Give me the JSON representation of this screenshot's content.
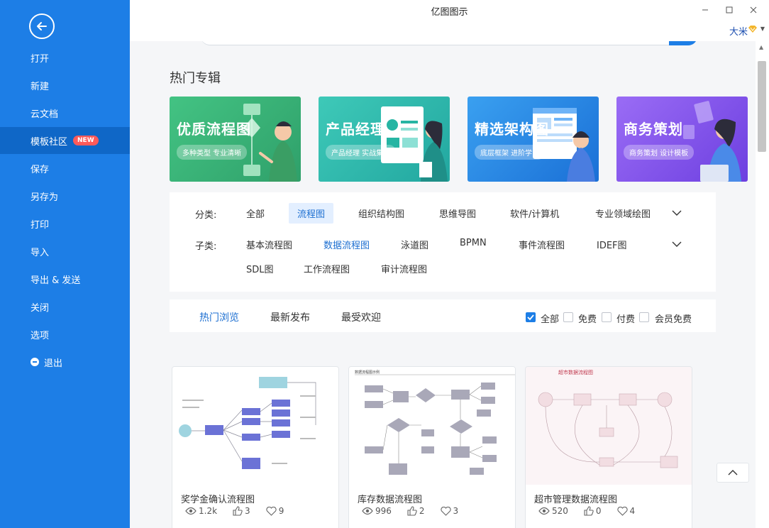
{
  "app": {
    "title": "亿图图示",
    "user_name": "大米"
  },
  "sidebar": {
    "items": [
      {
        "label": "打开"
      },
      {
        "label": "新建"
      },
      {
        "label": "云文档"
      },
      {
        "label": "模板社区",
        "badge": "NEW",
        "active": true
      },
      {
        "label": "保存"
      },
      {
        "label": "另存为"
      },
      {
        "label": "打印"
      },
      {
        "label": "导入"
      },
      {
        "label": "导出 & 发送"
      },
      {
        "label": "关闭"
      },
      {
        "label": "选项"
      },
      {
        "label": "退出"
      }
    ]
  },
  "main": {
    "section_title": "热门专辑",
    "banners": [
      {
        "title": "优质流程图",
        "subtitle": "多种类型 专业清晰",
        "color": "#3fbf7f"
      },
      {
        "title": "产品经理",
        "subtitle": "产品经理 实战集合",
        "color": "#34c3b5"
      },
      {
        "title": "精选架构图",
        "subtitle": "底层框架 进阶学习",
        "color": "#2f8ee8"
      },
      {
        "title": "商务策划",
        "subtitle": "商务策划 设计模板",
        "color": "#8a5cf0"
      }
    ],
    "filter": {
      "category_label": "分类:",
      "categories": [
        "全部",
        "流程图",
        "组织结构图",
        "思维导图",
        "软件/计算机",
        "专业领域绘图"
      ],
      "selected_category": "流程图",
      "subcategory_label": "子类:",
      "subcategories": [
        "基本流程图",
        "数据流程图",
        "泳道图",
        "BPMN",
        "事件流程图",
        "IDEF图",
        "SDL图",
        "工作流程图",
        "审计流程图"
      ],
      "selected_subcategory": "数据流程图"
    },
    "sort": {
      "tabs": [
        "热门浏览",
        "最新发布",
        "最受欢迎"
      ],
      "active_tab": "热门浏览",
      "checkboxes": [
        {
          "label": "全部",
          "checked": true
        },
        {
          "label": "免费",
          "checked": false
        },
        {
          "label": "付费",
          "checked": false
        },
        {
          "label": "会员免费",
          "checked": false
        }
      ]
    },
    "cards": [
      {
        "title": "奖学金确认流程图",
        "views": "1.2k",
        "likes": "3",
        "favorites": "9"
      },
      {
        "title": "库存数据流程图",
        "views": "996",
        "likes": "2",
        "favorites": "3",
        "thumb_title": "数据流程图示例"
      },
      {
        "title": "超市管理数据流程图",
        "views": "520",
        "likes": "0",
        "favorites": "4",
        "thumb_title": "超市数据流程图"
      }
    ]
  },
  "colors": {
    "accent": "#1d7ee6",
    "badge": "#ff5a5a"
  }
}
